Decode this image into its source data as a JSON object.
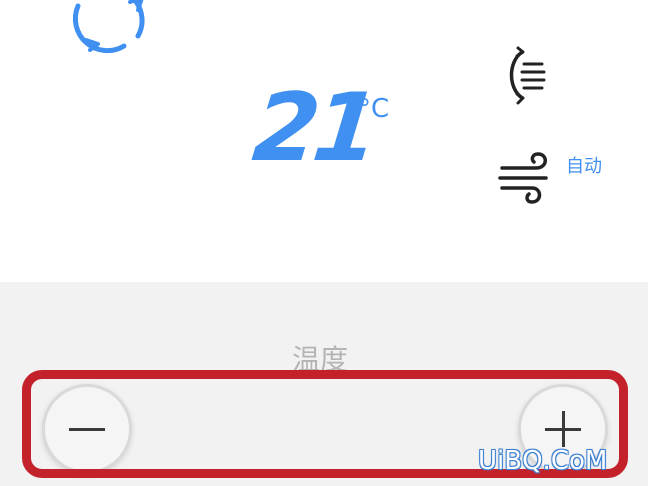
{
  "display": {
    "mode_icon": "cycle-icon",
    "temperature_value": "21",
    "temperature_unit": "°C",
    "swing_icon": "swing-icon",
    "wind_icon": "wind-icon",
    "wind_mode": "自动"
  },
  "control": {
    "label": "温度",
    "decrease_icon": "minus-icon",
    "increase_icon": "plus-icon"
  },
  "watermark": "UiBQ.CoM",
  "colors": {
    "accent": "#3f90f0",
    "annotation": "#c4222a",
    "panel": "#f2f2f2"
  }
}
